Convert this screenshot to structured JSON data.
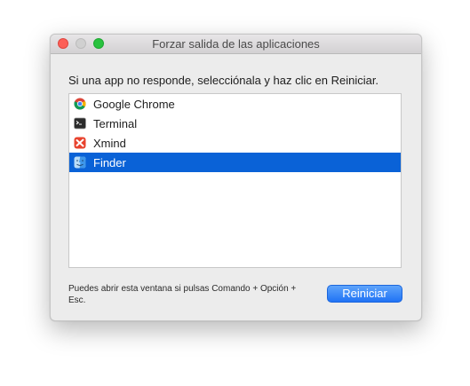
{
  "window": {
    "title": "Forzar salida de las aplicaciones"
  },
  "prompt": "Si una app no responde, selecciónala y haz clic en Reiniciar.",
  "apps": [
    {
      "name": "Google Chrome",
      "icon": "chrome-icon",
      "selected": false
    },
    {
      "name": "Terminal",
      "icon": "terminal-icon",
      "selected": false
    },
    {
      "name": "Xmind",
      "icon": "xmind-icon",
      "selected": false
    },
    {
      "name": "Finder",
      "icon": "finder-icon",
      "selected": true
    }
  ],
  "hint": "Puedes abrir esta ventana si pulsas Comando + Opción + Esc.",
  "button": {
    "label": "Reiniciar"
  },
  "colors": {
    "selection": "#0a62d7",
    "button": "#2073f5",
    "close": "#fc5f57",
    "zoom": "#29c23f"
  }
}
